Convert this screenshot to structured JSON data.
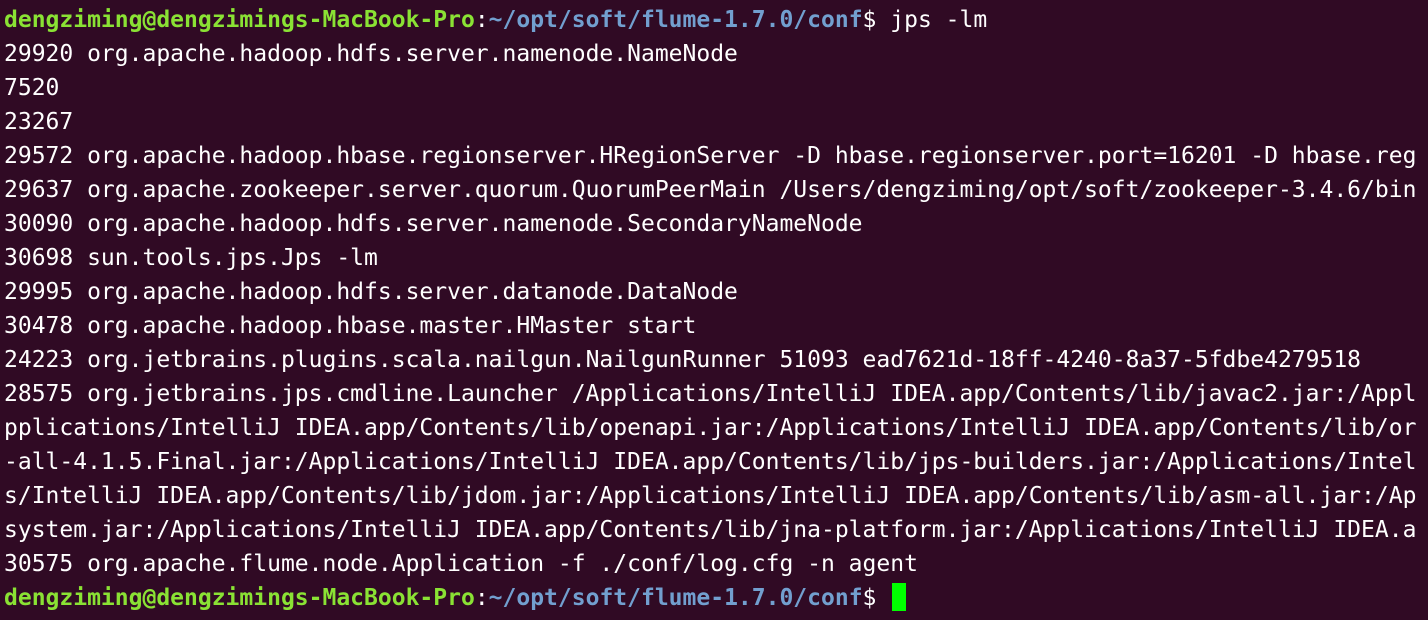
{
  "prompt": {
    "user_host": "dengziming@dengzimings-MacBook-Pro",
    "separator": ":",
    "path": "~/opt/soft/flume-1.7.0/conf",
    "symbol": "$ "
  },
  "command": "jps -lm",
  "output_lines": [
    "29920 org.apache.hadoop.hdfs.server.namenode.NameNode",
    "7520",
    "23267",
    "29572 org.apache.hadoop.hbase.regionserver.HRegionServer -D hbase.regionserver.port=16201 -D hbase.reg",
    "29637 org.apache.zookeeper.server.quorum.QuorumPeerMain /Users/dengziming/opt/soft/zookeeper-3.4.6/bin",
    "30090 org.apache.hadoop.hdfs.server.namenode.SecondaryNameNode",
    "30698 sun.tools.jps.Jps -lm",
    "29995 org.apache.hadoop.hdfs.server.datanode.DataNode",
    "30478 org.apache.hadoop.hbase.master.HMaster start",
    "24223 org.jetbrains.plugins.scala.nailgun.NailgunRunner 51093 ead7621d-18ff-4240-8a37-5fdbe4279518",
    "28575 org.jetbrains.jps.cmdline.Launcher /Applications/IntelliJ IDEA.app/Contents/lib/javac2.jar:/Appl",
    "pplications/IntelliJ IDEA.app/Contents/lib/openapi.jar:/Applications/IntelliJ IDEA.app/Contents/lib/or",
    "-all-4.1.5.Final.jar:/Applications/IntelliJ IDEA.app/Contents/lib/jps-builders.jar:/Applications/Intel",
    "s/IntelliJ IDEA.app/Contents/lib/jdom.jar:/Applications/IntelliJ IDEA.app/Contents/lib/asm-all.jar:/Ap",
    "system.jar:/Applications/IntelliJ IDEA.app/Contents/lib/jna-platform.jar:/Applications/IntelliJ IDEA.a",
    "30575 org.apache.flume.node.Application -f ./conf/log.cfg -n agent"
  ],
  "colors": {
    "background": "#300a24",
    "prompt_user": "#8ae234",
    "prompt_path": "#729fcf",
    "text": "#ffffff",
    "cursor": "#00ff00"
  }
}
